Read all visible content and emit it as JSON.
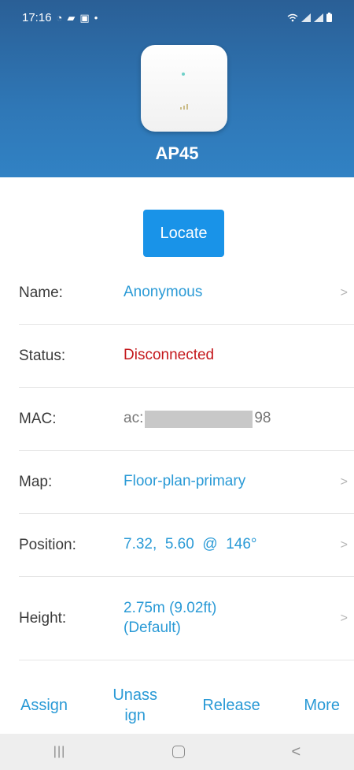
{
  "status_bar": {
    "time": "17:16",
    "left_icons": [
      "whatsapp-icon",
      "message-icon",
      "gallery-icon",
      "dot-icon"
    ],
    "right_icons": [
      "wifi-icon",
      "signal-icon",
      "signal-icon",
      "battery-icon"
    ]
  },
  "device": {
    "title": "AP45"
  },
  "locate_label": "Locate",
  "properties": {
    "name": {
      "label": "Name:",
      "value": "Anonymous"
    },
    "status": {
      "label": "Status:",
      "value": "Disconnected",
      "color": "#c4181c"
    },
    "mac": {
      "label": "MAC:",
      "prefix": "ac:",
      "suffix": "98"
    },
    "map": {
      "label": "Map:",
      "value": "Floor-plan-primary"
    },
    "position": {
      "label": "Position:",
      "value": "7.32,  5.60  @  146°"
    },
    "height": {
      "label": "Height:",
      "value": "2.75m (9.02ft) (Default)"
    }
  },
  "actions": {
    "assign": "Assign",
    "unassign": "Unassign",
    "release": "Release",
    "more": "More"
  },
  "colors": {
    "header": "#2f77b6",
    "accent": "#1993e8",
    "link": "#2a9ad6",
    "error": "#c4181c"
  }
}
